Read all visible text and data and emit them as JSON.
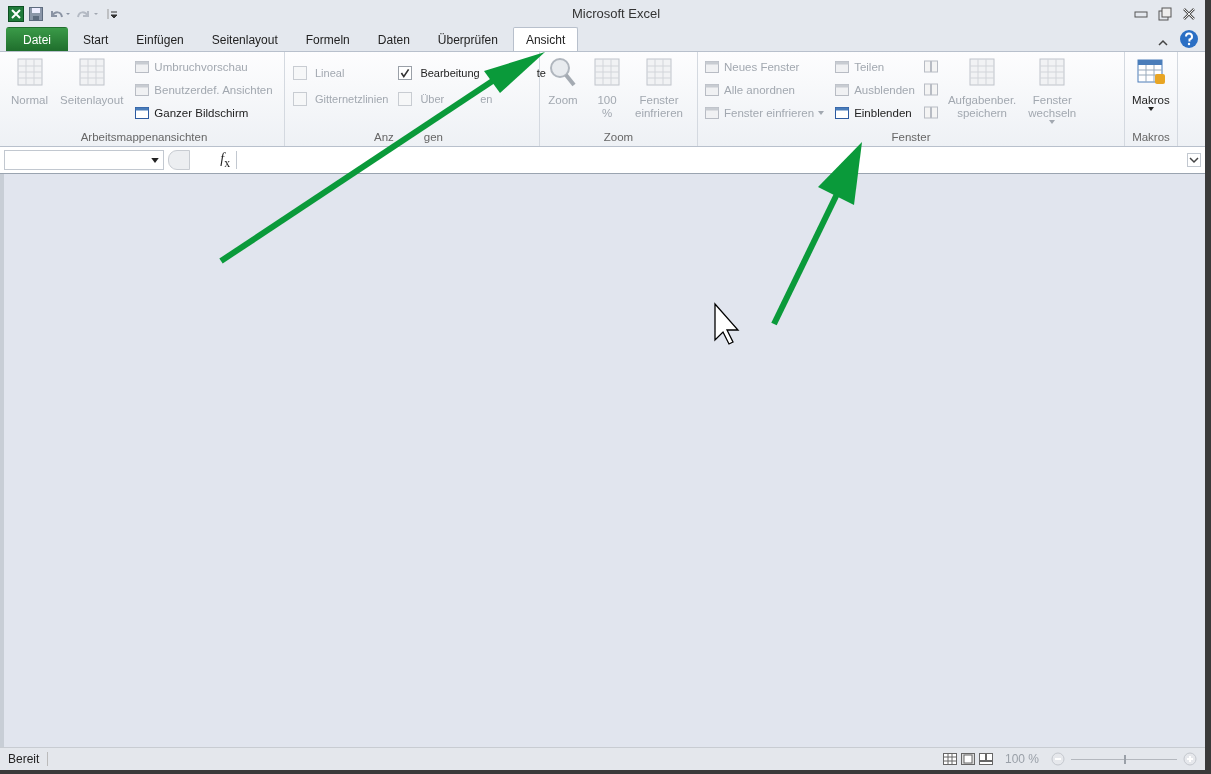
{
  "window": {
    "title": "Microsoft Excel"
  },
  "tabs": [
    {
      "label": "Datei",
      "kind": "file",
      "selected": false
    },
    {
      "label": "Start",
      "kind": "tab",
      "selected": false
    },
    {
      "label": "Einfügen",
      "kind": "tab",
      "selected": false
    },
    {
      "label": "Seitenlayout",
      "kind": "tab",
      "selected": false
    },
    {
      "label": "Formeln",
      "kind": "tab",
      "selected": false
    },
    {
      "label": "Daten",
      "kind": "tab",
      "selected": false
    },
    {
      "label": "Überprüfen",
      "kind": "tab",
      "selected": false
    },
    {
      "label": "Ansicht",
      "kind": "tab",
      "selected": true
    }
  ],
  "ribbon": {
    "groups": [
      {
        "label_parts": [
          "Arbeitsmappenansichten"
        ],
        "columns": [
          {
            "kind": "big",
            "lines": [
              "Normal"
            ],
            "disabled": true,
            "dropdown": false
          },
          {
            "kind": "big",
            "lines": [
              "Seitenlayout"
            ],
            "disabled": true,
            "dropdown": false
          },
          {
            "kind": "stack",
            "items": [
              {
                "label": "Umbruchvorschau",
                "disabled": true,
                "dropdown": false
              },
              {
                "label": "Benutzerdef. Ansichten",
                "disabled": true,
                "dropdown": false
              },
              {
                "label": "Ganzer Bildschirm",
                "disabled": false,
                "dropdown": false
              }
            ]
          }
        ]
      },
      {
        "label_parts": [
          "Anz",
          "gen"
        ],
        "columns": [
          {
            "kind": "checks",
            "items": [
              {
                "label_parts": [
                  "Lineal"
                ],
                "checked": false,
                "disabled": true
              },
              {
                "label_parts": [
                  "Gitternetzlinien"
                ],
                "checked": false,
                "disabled": true
              }
            ]
          },
          {
            "kind": "checks",
            "items": [
              {
                "label_parts": [
                  "Bearbeitung",
                  "te"
                ],
                "checked": true,
                "disabled": false
              },
              {
                "label_parts": [
                  "Über",
                  "en"
                ],
                "checked": false,
                "disabled": true
              }
            ]
          }
        ]
      },
      {
        "label_parts": [
          "Zoom"
        ],
        "columns": [
          {
            "kind": "big",
            "lines": [
              "Zoom"
            ],
            "disabled": true,
            "dropdown": false
          },
          {
            "kind": "big",
            "lines": [
              "100",
              "%"
            ],
            "disabled": true,
            "dropdown": false
          },
          {
            "kind": "big",
            "lines": [
              "Fenster",
              "einfrieren"
            ],
            "disabled": true,
            "dropdown": false
          }
        ]
      },
      {
        "label_parts": [
          "Fenster"
        ],
        "columns": [
          {
            "kind": "stack",
            "items": [
              {
                "label": "Neues Fenster",
                "disabled": true,
                "dropdown": false
              },
              {
                "label": "Alle anordnen",
                "disabled": true,
                "dropdown": false
              },
              {
                "label": "Fenster einfrieren",
                "disabled": true,
                "dropdown": true
              }
            ]
          },
          {
            "kind": "stack",
            "items": [
              {
                "label": "Teilen",
                "disabled": true,
                "dropdown": false
              },
              {
                "label": "Ausblenden",
                "disabled": true,
                "dropdown": false
              },
              {
                "label": "Einblenden",
                "disabled": false,
                "dropdown": false
              }
            ]
          },
          {
            "kind": "iconstack",
            "items": [
              {
                "disabled": true
              },
              {
                "disabled": true
              },
              {
                "disabled": true
              }
            ]
          },
          {
            "kind": "big",
            "lines": [
              "Aufgabenber.",
              "speichern"
            ],
            "disabled": true,
            "dropdown": false
          },
          {
            "kind": "big",
            "lines": [
              "Fenster",
              "wechseln"
            ],
            "disabled": true,
            "dropdown": true
          }
        ]
      },
      {
        "label_parts": [
          "Makros"
        ],
        "columns": [
          {
            "kind": "big",
            "lines": [
              "Makros"
            ],
            "disabled": false,
            "dropdown": true
          }
        ]
      }
    ]
  },
  "formula_bar": {
    "fx": "*f*$_{x}$"
  },
  "status_bar": {
    "status": "Bereit",
    "zoom": "100 %",
    "zoom_slider": {
      "level": 0.5
    }
  }
}
